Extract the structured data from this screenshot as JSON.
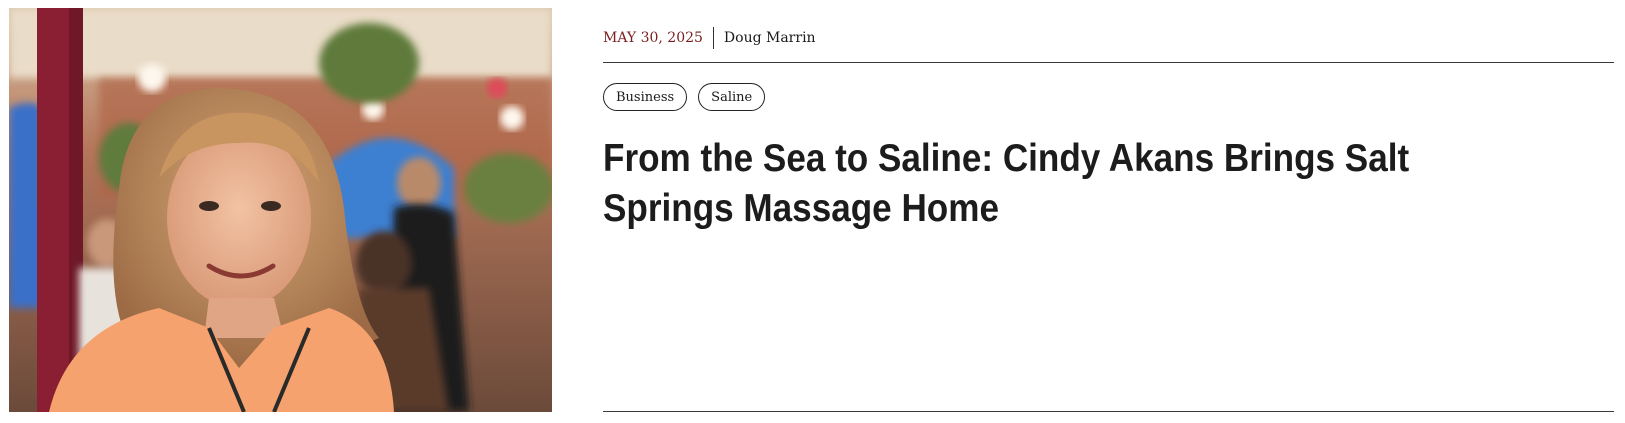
{
  "article": {
    "date": "MAY 30, 2025",
    "author": "Doug Marrin",
    "tags": [
      "Business",
      "Saline"
    ],
    "title": "From the Sea to Saline: Cindy Akans Brings Salt Springs Massage Home"
  },
  "image": {
    "icon": "photo-portrait"
  },
  "colors": {
    "date": "#7a1f1f",
    "text": "#1c1c1c",
    "rule": "#3a3a3a"
  }
}
